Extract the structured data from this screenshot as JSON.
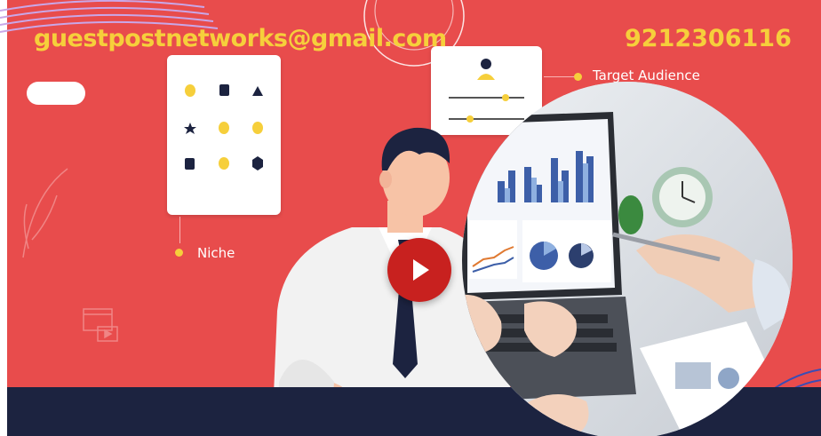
{
  "banner": {
    "email": "guestpostnetworks@gmail.com",
    "phone": "9212306116",
    "labels": {
      "target_audience": "Target Audience",
      "niche": "Niche"
    },
    "colors": {
      "background": "#e84c4c",
      "text_accent": "#f6cf3b",
      "navy": "#1c2340",
      "play_button": "#c8211f"
    },
    "icons": [
      "play-icon",
      "target-audience-icon",
      "niche-icon"
    ]
  }
}
